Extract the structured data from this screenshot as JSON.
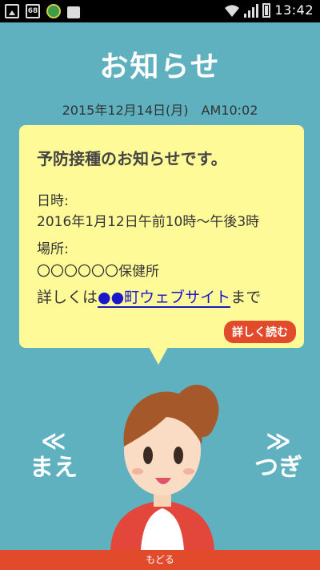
{
  "status_bar": {
    "time": "13:42",
    "badge_text": "68",
    "icons": [
      "image-icon",
      "badge-icon",
      "globe-icon",
      "bag-icon",
      "wifi-icon",
      "signal-icon",
      "battery-icon"
    ]
  },
  "header": {
    "title": "お知らせ"
  },
  "notice": {
    "datetime": "2015年12月14日(月)　AM10:02",
    "heading": "予防接種のお知らせです。",
    "date_label": "日時:",
    "date_value": "2016年1月12日午前10時〜午後3時",
    "place_label": "場所:",
    "place_value": "〇〇〇〇〇〇保健所",
    "more_prefix": "詳しくは",
    "more_link": "●●町ウェブサイト",
    "more_suffix": "まで",
    "read_more_button": "詳しく読む"
  },
  "navigation": {
    "prev_arrow": "≪",
    "prev_label": "まえ",
    "next_arrow": "≫",
    "next_label": "つぎ"
  },
  "footer": {
    "back_label": "もどる"
  },
  "colors": {
    "background": "#5fb1bf",
    "card": "#fefa98",
    "accent": "#e14a2a",
    "link": "#1a17c9"
  }
}
